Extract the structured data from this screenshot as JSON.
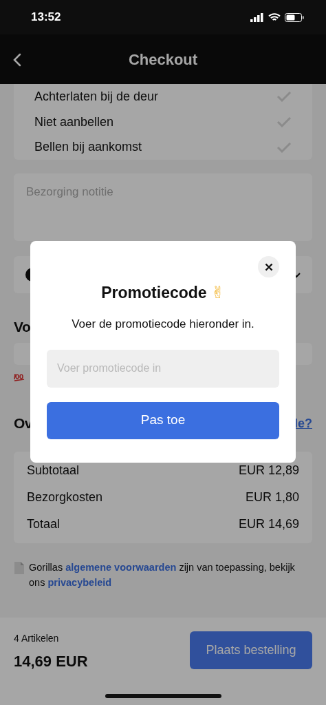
{
  "status_bar": {
    "time": "13:52"
  },
  "header": {
    "title": "Checkout"
  },
  "delivery_options": [
    {
      "label": "Achterlaten bij de deur"
    },
    {
      "label": "Niet aanbellen"
    },
    {
      "label": "Bellen bij aankomst"
    }
  ],
  "note_field": {
    "placeholder": "Bezorging notitie"
  },
  "voucher_heading": "Vo",
  "overview": {
    "heading": "Ov",
    "link": "le?"
  },
  "summary": [
    {
      "label": "Subtotaal",
      "value": "EUR 12,89"
    },
    {
      "label": "Bezorgkosten",
      "value": "EUR 1,80"
    },
    {
      "label": "Totaal",
      "value": "EUR 14,69"
    }
  ],
  "terms": {
    "prefix": "Gorillas",
    "link1": "algemene voorwaarden",
    "middle": "zijn van toepassing, bekijk ons",
    "link2": "privacybeleid"
  },
  "footer": {
    "items": "4 Artikelen",
    "total": "14,69 EUR",
    "button": "Plaats bestelling"
  },
  "modal": {
    "title": "Promotiecode",
    "emoji": "✌",
    "subtitle": "Voer de promotiecode hieronder in.",
    "input": {
      "placeholder": "Voer promotiecode in"
    },
    "button": "Pas toe"
  }
}
